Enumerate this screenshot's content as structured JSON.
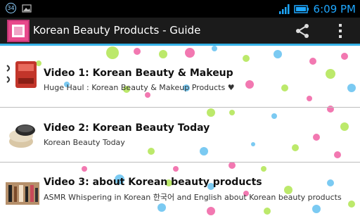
{
  "status_bar": {
    "notification_badge": "34",
    "time": "6:09 PM",
    "icons": [
      "notification-count-icon",
      "image-icon",
      "signal-icon",
      "battery-icon"
    ]
  },
  "action_bar": {
    "title": "Korean Beauty Products - Guide",
    "icons": [
      "app-icon",
      "share-icon",
      "overflow-menu-icon"
    ]
  },
  "videos": [
    {
      "title": "Video 1: Korean Beauty & Makeup",
      "subtitle": "Huge Haul : Korean Beauty & Makeup Products ♥"
    },
    {
      "title": "Video 2: Korean Beauty Today",
      "subtitle": "Korean Beauty Today"
    },
    {
      "title": "Video 3: about Korean beauty products",
      "subtitle": "ASMR Whispering in Korean 한국어 and English about Korean beauty products"
    }
  ],
  "colors": {
    "status_time": "#1ea7ff",
    "accent_line": "#36b2e8",
    "action_bar": "#1b1b1b",
    "bubble_pink": "#ee4c97",
    "bubble_green": "#a6e23a",
    "bubble_blue": "#4fb9ee"
  }
}
